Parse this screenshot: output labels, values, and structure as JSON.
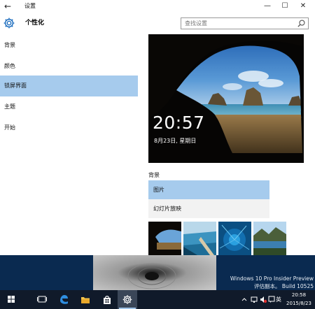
{
  "window": {
    "title": "设置",
    "back_glyph": "←",
    "minimize_glyph": "—",
    "maximize_glyph": "☐",
    "close_glyph": "✕"
  },
  "header": {
    "section_title": "个性化",
    "search_placeholder": "查找设置"
  },
  "sidebar": {
    "items": [
      {
        "label": "背景",
        "active": false
      },
      {
        "label": "颜色",
        "active": false
      },
      {
        "label": "锁屏界面",
        "active": true
      },
      {
        "label": "主题",
        "active": false
      },
      {
        "label": "开始",
        "active": false
      }
    ]
  },
  "preview": {
    "time": "20:57",
    "date": "8月23日, 星期日"
  },
  "background": {
    "label": "背景",
    "options": [
      {
        "label": "图片",
        "selected": true
      },
      {
        "label": "幻灯片放映",
        "selected": false
      }
    ]
  },
  "watermark": {
    "line1": "Windows 10 Pro Insider Preview",
    "line2": "评估副本。 Build 10525"
  },
  "taskbar": {
    "ime": "英",
    "tray_time": "20:58",
    "tray_date": "2015/8/23"
  },
  "colors": {
    "accent_selection": "#a6cbed",
    "taskbar": "#101a2a",
    "desktop": "#0a2a50"
  }
}
